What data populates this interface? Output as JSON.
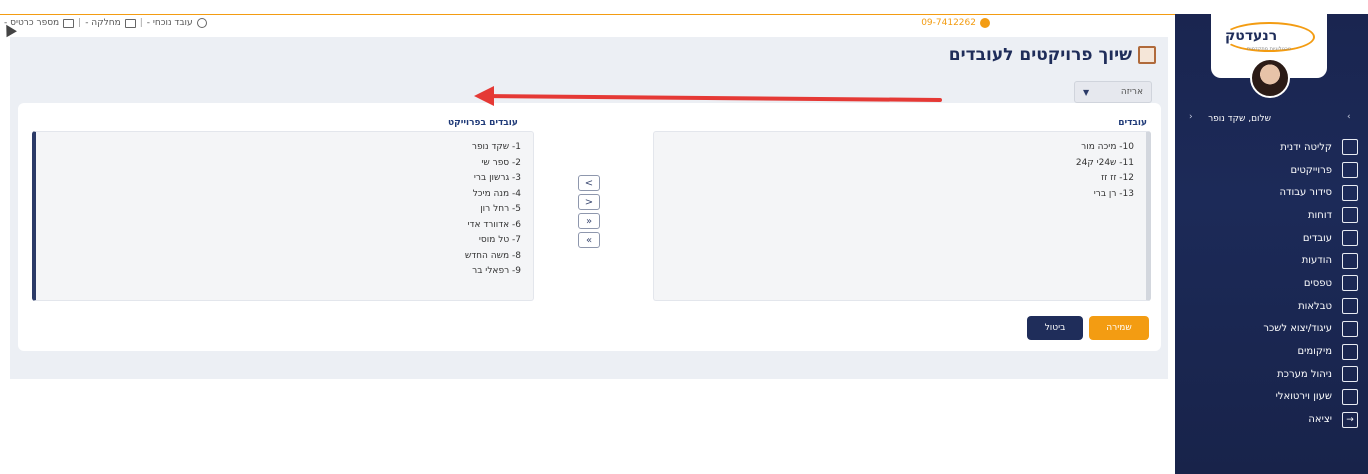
{
  "topbar": {
    "employee_label": "עובד נוכחי -",
    "department_label": "מחלקה -",
    "cards_label": "מספר כרטיס -",
    "phone": "09-7412262"
  },
  "page": {
    "title": "שיוך פרויקטים לעובדים",
    "project_select": "אריזה"
  },
  "employees_list": {
    "title": "עובדים",
    "items": [
      "10- מיכה מור",
      "11- ש24י ק24",
      "12- זז זז",
      "13- רן ברי"
    ]
  },
  "project_list": {
    "title": "עובדים בפרוייקט",
    "items": [
      "1- שקד נופר",
      "2- ספר שי",
      "3- גרשון ברי",
      "4- מנה מיכל",
      "5- רחל רון",
      "6- אדוורד אדי",
      "7- טל מוסי",
      "8- משה החדש",
      "9- רפאלי בר"
    ]
  },
  "move_buttons": [
    "<",
    ">",
    "»",
    "«"
  ],
  "actions": {
    "save": "שמירה",
    "cancel": "ביטול"
  },
  "sidebar": {
    "logo": "רנעדטק",
    "logo_sub": "טכנולוגיות מתקדמות",
    "greeting": "שלום, שקד נופר",
    "items": [
      {
        "label": "קליטה ידנית",
        "icon": "id-card-icon"
      },
      {
        "label": "פרוייקטים",
        "icon": "edit-icon"
      },
      {
        "label": "סידור עבודה",
        "icon": "calendar-icon"
      },
      {
        "label": "דוחות",
        "icon": "report-icon"
      },
      {
        "label": "עובדים",
        "icon": "users-icon"
      },
      {
        "label": "הודעות",
        "icon": "message-icon"
      },
      {
        "label": "טפסים",
        "icon": "clipboard-icon"
      },
      {
        "label": "טבלאות",
        "icon": "grid-icon"
      },
      {
        "label": "עיגוד/יצוא לשכר",
        "icon": "export-icon"
      },
      {
        "label": "מיקומים",
        "icon": "location-icon"
      },
      {
        "label": "ניהול מערכת",
        "icon": "admin-icon"
      },
      {
        "label": "שעון וירטואלי",
        "icon": "clock-icon"
      },
      {
        "label": "יציאה",
        "icon": "logout-icon"
      }
    ]
  },
  "colors": {
    "accent": "#f39c12",
    "navy": "#1f2d5a",
    "annotation_arrow": "#e53935"
  }
}
